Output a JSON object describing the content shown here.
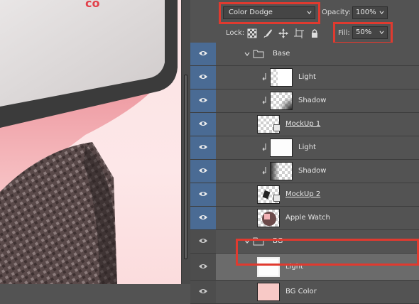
{
  "canvas": {
    "screen_text": "co",
    "bg_color": "#fde6e7",
    "watch_color": "#f2a9ae",
    "bezel_color": "#3a3a3a"
  },
  "toolbar": {
    "blend_mode": "Color Dodge",
    "opacity_label": "Opacity:",
    "opacity_value": "100%",
    "lock_label": "Lock:",
    "fill_label": "Fill:",
    "fill_value": "50%"
  },
  "layers": [
    {
      "name": "Base",
      "kind": "group",
      "expanded": true
    },
    {
      "name": "Light",
      "kind": "layer",
      "clipped": true,
      "thumb": "checker-white"
    },
    {
      "name": "Shadow",
      "kind": "layer",
      "clipped": true,
      "thumb": "checker-shadow"
    },
    {
      "name": "MockUp 1",
      "kind": "smart",
      "underlined": true,
      "thumb": "checker"
    },
    {
      "name": "Light",
      "kind": "layer",
      "clipped": true,
      "thumb": "white"
    },
    {
      "name": "Shadow",
      "kind": "layer",
      "clipped": true,
      "thumb": "checker-shadow"
    },
    {
      "name": "MockUp 2",
      "kind": "smart",
      "underlined": true,
      "thumb": "checker-art"
    },
    {
      "name": "Apple Watch",
      "kind": "layer",
      "thumb": "watch"
    },
    {
      "name": "BG",
      "kind": "group",
      "expanded": true
    },
    {
      "name": "Light",
      "kind": "layer",
      "selected": true,
      "thumb": "white"
    },
    {
      "name": "BG Color",
      "kind": "layer",
      "thumb": "pink"
    }
  ],
  "colors": {
    "highlight": "#e03a2f",
    "panel": "#535353",
    "eye_active": "#4a6b94",
    "selected_row": "#6b6b6b"
  }
}
